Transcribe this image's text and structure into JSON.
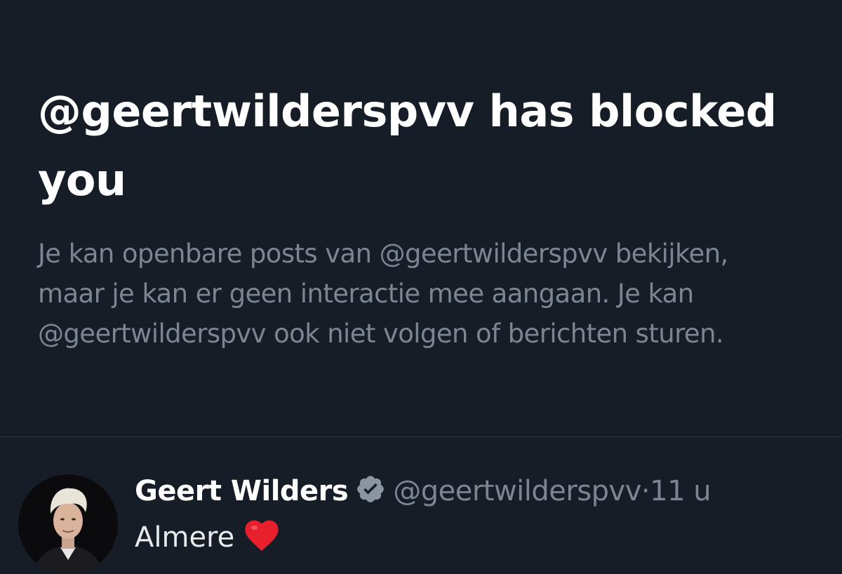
{
  "blocked_notice": {
    "heading_lines": [
      "@geertwilderspvv has blocked",
      "you"
    ],
    "description_lines": [
      "Je kan openbare posts van @geertwilderspvv bekijken,",
      "maar je kan er geen interactie mee aangaan. Je kan",
      "@geertwilderspvv ook niet volgen of berichten sturen."
    ]
  },
  "post": {
    "author_name": "Geert Wilders",
    "handle": "@geertwilderspvv",
    "separator": "·",
    "time": "11 u",
    "text": "Almere",
    "verified_icon": "verified-badge-icon",
    "emoji_icon": "heart-icon"
  },
  "colors": {
    "background": "#161d27",
    "heading_text": "#ffffff",
    "secondary_text": "#7c8591",
    "divider": "#2f3640",
    "verified_badge": "#8b95a2",
    "heart": "#e8202e"
  }
}
